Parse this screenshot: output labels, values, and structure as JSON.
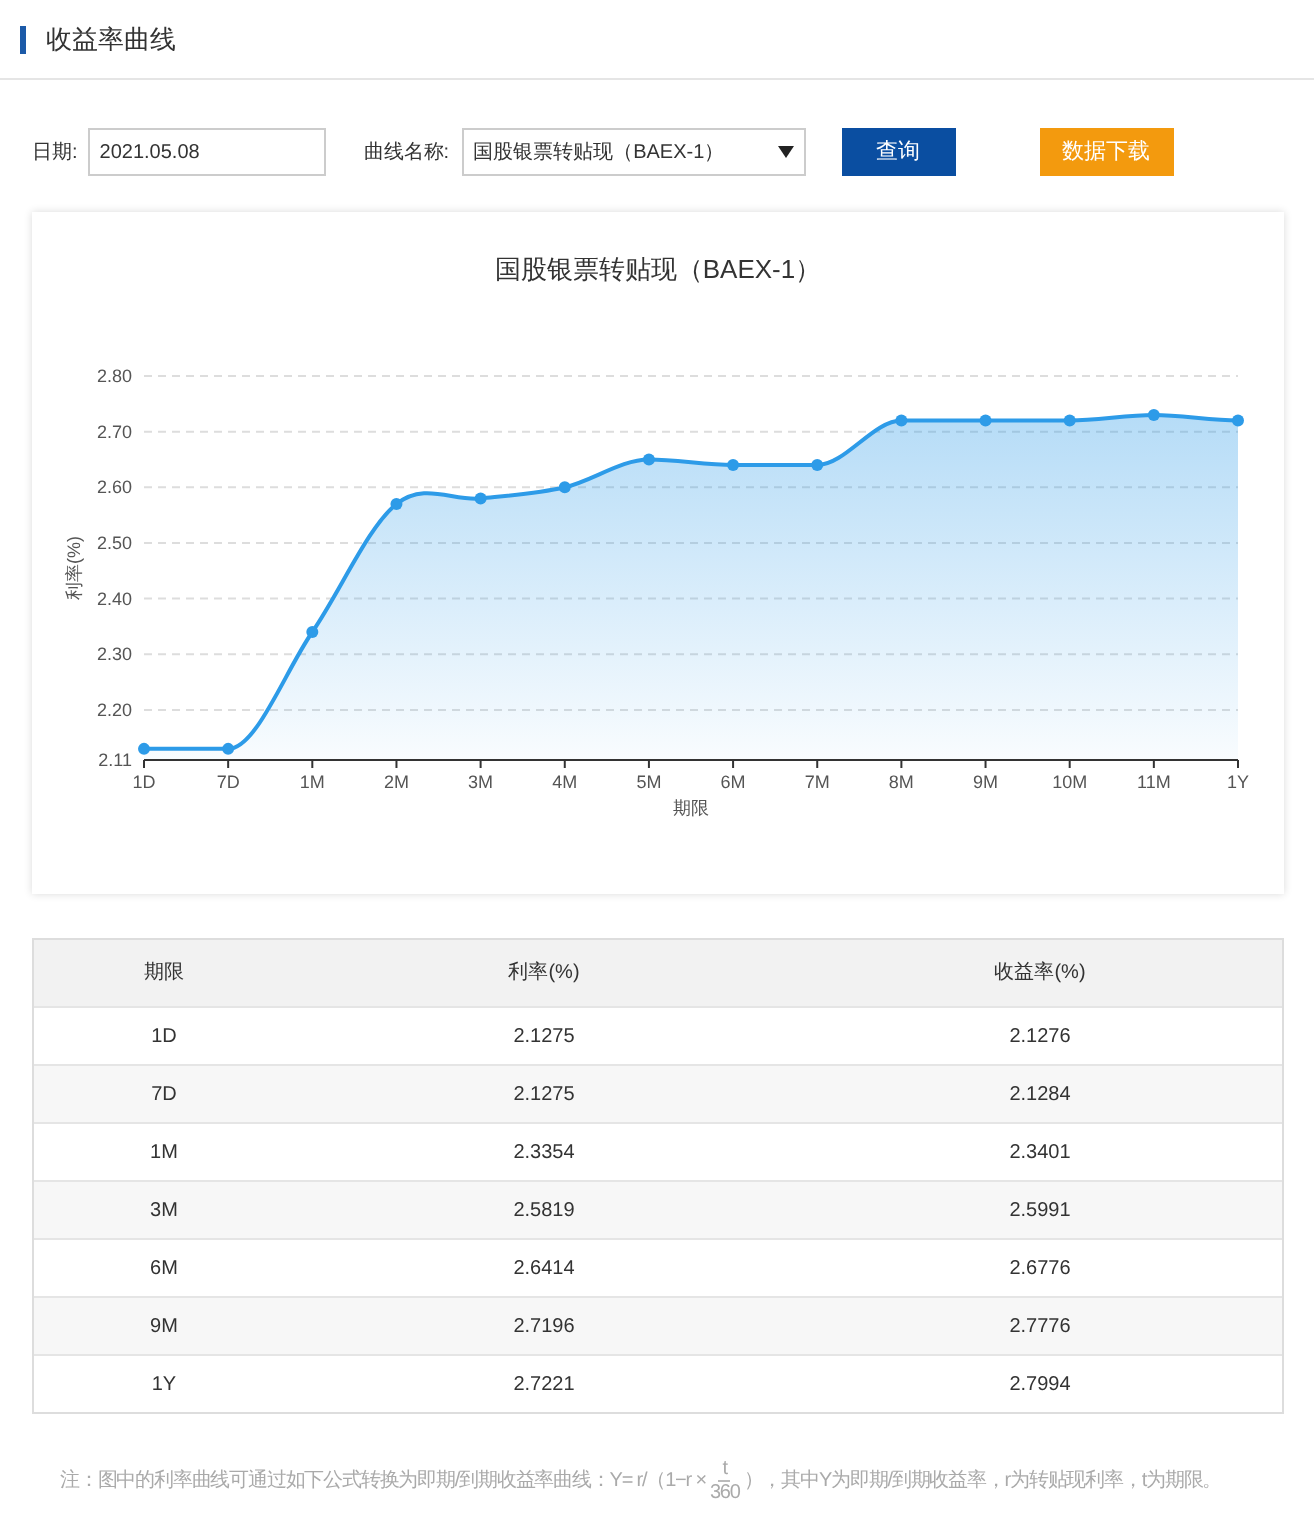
{
  "page_title": "收益率曲线",
  "form": {
    "date_label": "日期:",
    "date_value": "2021.05.08",
    "curve_label": "曲线名称:",
    "curve_value": "国股银票转贴现（BAEX-1）",
    "query_button": "查询",
    "download_button": "数据下载"
  },
  "chart": {
    "chart_data": {
      "type": "area",
      "title": "国股银票转贴现（BAEX-1）",
      "xlabel": "期限",
      "ylabel": "利率(%)",
      "categories": [
        "1D",
        "7D",
        "1M",
        "2M",
        "3M",
        "4M",
        "5M",
        "6M",
        "7M",
        "8M",
        "9M",
        "10M",
        "11M",
        "1Y"
      ],
      "series": [
        {
          "color": "#2d9be8",
          "values": [
            2.13,
            2.13,
            2.34,
            2.57,
            2.58,
            2.6,
            2.65,
            2.64,
            2.64,
            2.72,
            2.72,
            2.72,
            2.73,
            2.72
          ]
        }
      ],
      "grid": true,
      "ylim": [
        2.11,
        2.8
      ],
      "yticks": [
        {
          "value": 2.11,
          "label": "2.11"
        },
        {
          "value": 2.2,
          "label": "2.20"
        },
        {
          "value": 2.3,
          "label": "2.30"
        },
        {
          "value": 2.4,
          "label": "2.40"
        },
        {
          "value": 2.5,
          "label": "2.50"
        },
        {
          "value": 2.6,
          "label": "2.60"
        },
        {
          "value": 2.7,
          "label": "2.70"
        },
        {
          "value": 2.8,
          "label": "2.80"
        }
      ]
    }
  },
  "table": {
    "columns": [
      "期限",
      "利率(%)",
      "收益率(%)"
    ],
    "rows": [
      [
        "1D",
        "2.1275",
        "2.1276"
      ],
      [
        "7D",
        "2.1275",
        "2.1284"
      ],
      [
        "1M",
        "2.3354",
        "2.3401"
      ],
      [
        "3M",
        "2.5819",
        "2.5991"
      ],
      [
        "6M",
        "2.6414",
        "2.6776"
      ],
      [
        "9M",
        "2.7196",
        "2.7776"
      ],
      [
        "1Y",
        "2.7221",
        "2.7994"
      ]
    ]
  },
  "footnote": {
    "before": "注：图中的利率曲线可通过如下公式转换为即期/到期收益率曲线：",
    "formula_left": "Y= r/（1−r ×",
    "numerator": "t",
    "denominator": "360",
    "formula_right": "），",
    "after": "其中Y为即期/到期收益率，r为转贴现利率，t为期限。"
  }
}
